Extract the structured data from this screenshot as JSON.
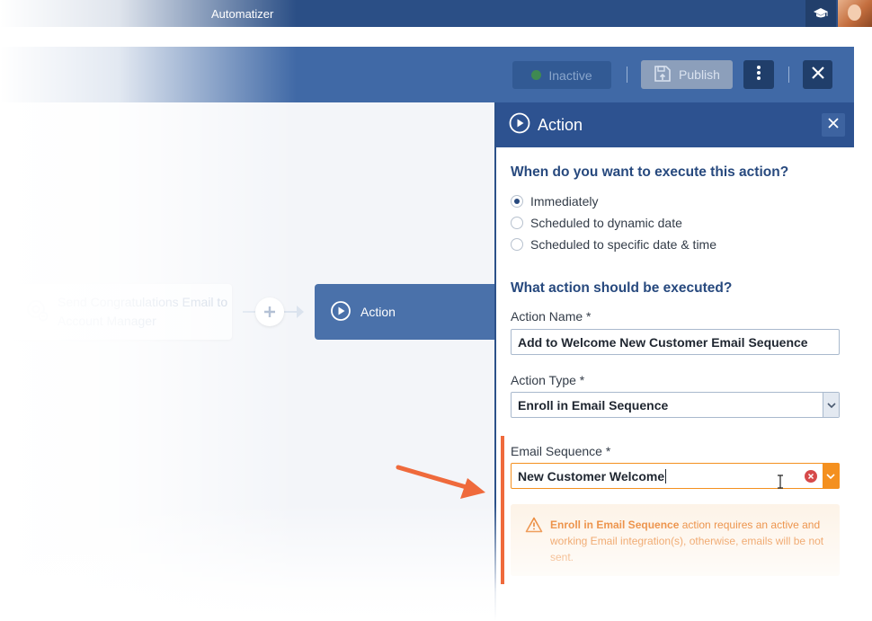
{
  "app": {
    "title": "Automatizer"
  },
  "toolbar": {
    "inactive_label": "Inactive",
    "publish_label": "Publish"
  },
  "canvas": {
    "previous_node_label": "Send Congratulations Email to Account Manager",
    "action_node_label": "Action"
  },
  "panel": {
    "title": "Action",
    "when_section": {
      "title": "When do you want to execute this action?",
      "options": [
        {
          "label": "Immediately",
          "selected": true
        },
        {
          "label": "Scheduled to dynamic date",
          "selected": false
        },
        {
          "label": "Scheduled to specific date & time",
          "selected": false
        }
      ]
    },
    "what_section": {
      "title": "What action should be executed?"
    },
    "fields": {
      "action_name": {
        "label": "Action Name *",
        "value": "Add to Welcome New Customer Email Sequence"
      },
      "action_type": {
        "label": "Action Type *",
        "value": "Enroll in Email Sequence"
      },
      "email_sequence": {
        "label": "Email Sequence *",
        "value": "New Customer Welcome"
      }
    },
    "warning": {
      "highlight": "Enroll in Email Sequence",
      "text": " action requires an active and working Email integration(s), otherwise, emails will be not sent."
    }
  },
  "colors": {
    "primary": "#2d5290",
    "accent_orange": "#f4901f",
    "warning_text": "#e8761a",
    "annotation": "#ef6a3c"
  },
  "icons": [
    "graduation-cap-icon",
    "avatar",
    "status-dot-icon",
    "save-publish-icon",
    "kebab-menu-icon",
    "close-icon",
    "play-circle-icon",
    "email-at-icon",
    "plus-icon",
    "chevron-down-icon",
    "clear-icon",
    "warning-icon",
    "text-cursor-icon",
    "pointer-arrow"
  ]
}
